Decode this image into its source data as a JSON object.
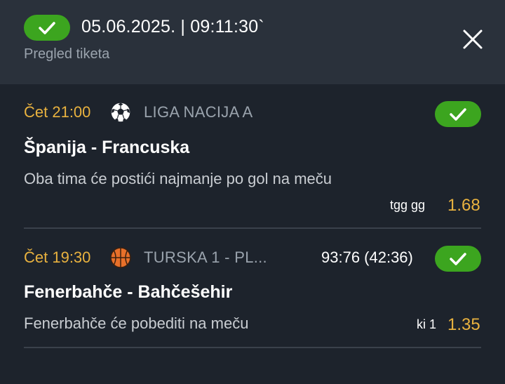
{
  "header": {
    "datetime": "05.06.2025. | 09:11:30`",
    "subtitle": "Pregled tiketa",
    "status_icon": "check-icon",
    "close_icon": "close-icon"
  },
  "colors": {
    "background": "#1d232c",
    "header_background": "#2a313b",
    "accent_green": "#3ca51f",
    "accent_orange": "#e9b23f"
  },
  "matches": [
    {
      "time": "Čet 21:00",
      "sport_icon": "football-icon",
      "league": "LIGA NACIJA A",
      "score": "",
      "teams": "Španija - Francuska",
      "pick": "Oba tima će postići najmanje po gol na meču",
      "code": "tgg gg",
      "odds": "1.68",
      "status_icon": "check-icon"
    },
    {
      "time": "Čet 19:30",
      "sport_icon": "basketball-icon",
      "league": "TURSKA 1 - PL...",
      "score": "93:76 (42:36)",
      "teams": "Fenerbahče - Bahčešehir",
      "pick": "Fenerbahče će pobediti na meču",
      "code": "ki 1",
      "odds": "1.35",
      "status_icon": "check-icon"
    }
  ]
}
